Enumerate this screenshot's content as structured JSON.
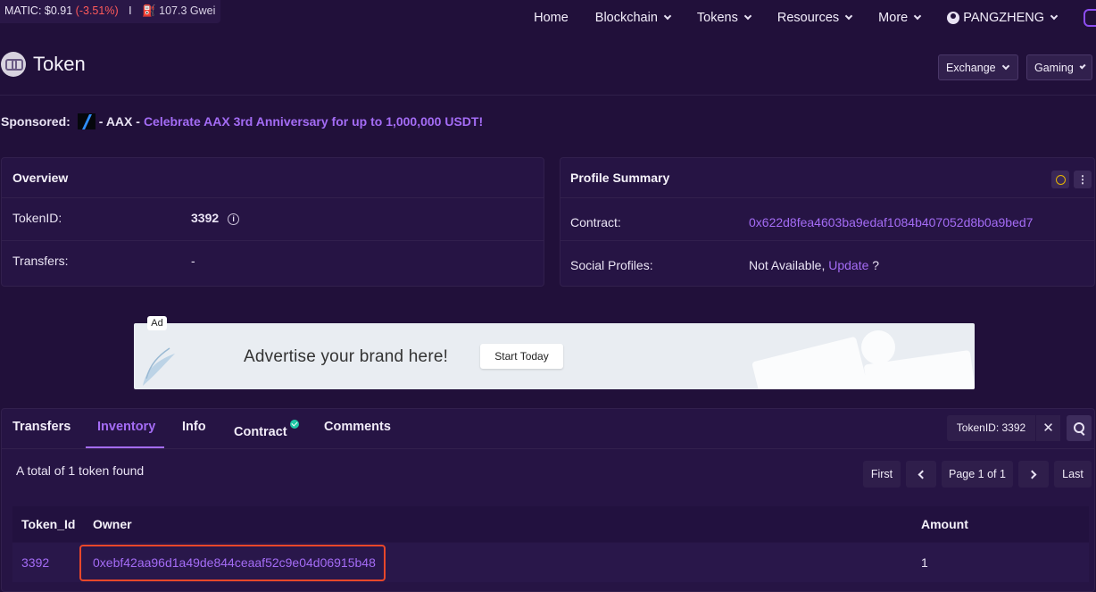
{
  "ticker": {
    "label": "MATIC: $0.91",
    "change": "(-3.51%)",
    "separator": "I",
    "gas_icon": "gas-pump-icon",
    "gas": "107.3 Gwei"
  },
  "nav": {
    "home": "Home",
    "blockchain": "Blockchain",
    "tokens": "Tokens",
    "resources": "Resources",
    "more": "More",
    "user": "PANGZHENG"
  },
  "header": {
    "title": "Token",
    "exchange": "Exchange",
    "gaming": "Gaming"
  },
  "sponsored": {
    "label": "Sponsored:",
    "brand": "- AAX -",
    "message": "Celebrate AAX 3rd Anniversary for up to 1,000,000 USDT!"
  },
  "overview": {
    "title": "Overview",
    "tokenid_label": "TokenID:",
    "tokenid_value": "3392",
    "transfers_label": "Transfers:",
    "transfers_value": "-"
  },
  "profile": {
    "title": "Profile Summary",
    "contract_label": "Contract:",
    "contract_value": "0x622d8fea4603ba9edaf1084b407052d8b0a9bed7",
    "social_label": "Social Profiles:",
    "social_value": "Not Available,",
    "social_link": "Update",
    "social_suffix": "?"
  },
  "ad": {
    "badge": "Ad",
    "text": "Advertise your brand here!",
    "button": "Start Today"
  },
  "tabs": [
    "Transfers",
    "Inventory",
    "Info",
    "Contract",
    "Comments"
  ],
  "active_tab": "Inventory",
  "filter": {
    "value": "TokenID: 3392",
    "clear": "✕"
  },
  "inventory": {
    "summary": "A total of 1 token found",
    "pagination": {
      "first": "First",
      "page": "Page 1 of 1",
      "last": "Last"
    },
    "columns": [
      "Token_Id",
      "Owner",
      "Amount"
    ],
    "rows": [
      {
        "token_id": "3392",
        "owner": "0xebf42aa96d1a49de844ceaaf52c9e04d06915b48",
        "amount": "1"
      }
    ]
  },
  "colors": {
    "background": "#21103a",
    "accent": "#a46cf5",
    "negative": "#ff5a5a",
    "highlight": "#e8472a",
    "verified": "#1fc7a5"
  }
}
